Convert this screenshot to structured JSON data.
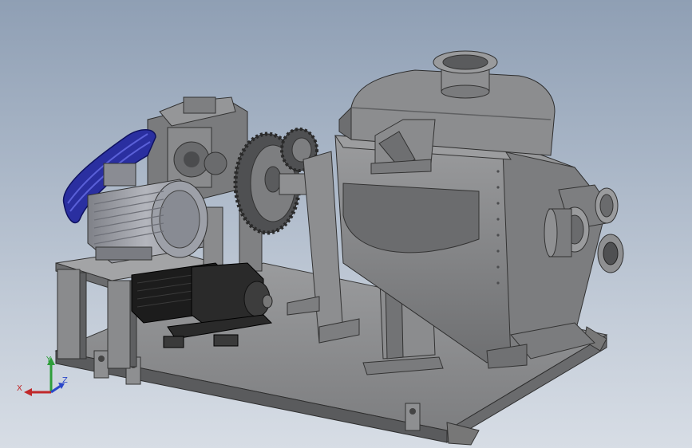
{
  "viewport": {
    "background_top": "#8f9fb4",
    "background_bottom": "#d7dde5"
  },
  "model": {
    "frame_color": "#8a8b8d",
    "shade_color": "#5f6062",
    "motor_color": "#9a9ca2",
    "belt_color": "#2a2fa0",
    "gearmotor_color": "#1c1c1c"
  },
  "triad": {
    "x_label": "X",
    "y_label": "Y",
    "z_label": "Z",
    "x_color": "#c0282a",
    "y_color": "#2e9e3a",
    "z_color": "#2b47c9"
  }
}
